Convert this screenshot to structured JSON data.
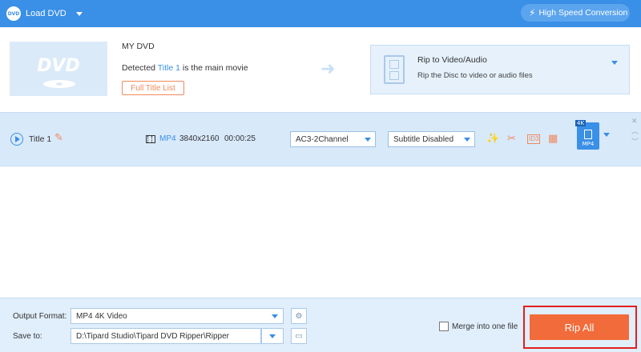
{
  "topbar": {
    "dvd_badge": "DVD",
    "load_label": "Load DVD",
    "high_speed_label": "High Speed Conversion",
    "accent_color": "#3a8fe6"
  },
  "source": {
    "disc_logo": "DVD",
    "dvd_title": "MY DVD",
    "detected_prefix": "Detected ",
    "detected_title": "Title 1",
    "detected_suffix": " is the main movie",
    "full_title_list": "Full Title List",
    "rip_title": "Rip to Video/Audio",
    "rip_subtitle": "Rip the Disc to video or audio files"
  },
  "title_row": {
    "title": "Title 1",
    "format": "MP4",
    "resolution": "3840x2160",
    "duration": "00:00:25",
    "audio": "AC3-2Channel",
    "subtitle": "Subtitle Disabled",
    "id3_label": "ID3",
    "output_badge": "4K",
    "output_label": "MP4"
  },
  "bottom": {
    "output_format_label": "Output Format:",
    "output_format_value": "MP4 4K Video",
    "save_to_label": "Save to:",
    "save_to_value": "D:\\Tipard Studio\\Tipard DVD Ripper\\Ripper",
    "merge_label": "Merge into one file",
    "rip_all": "Rip All",
    "rip_all_color": "#f26b3a",
    "highlight_color": "#e02020"
  }
}
